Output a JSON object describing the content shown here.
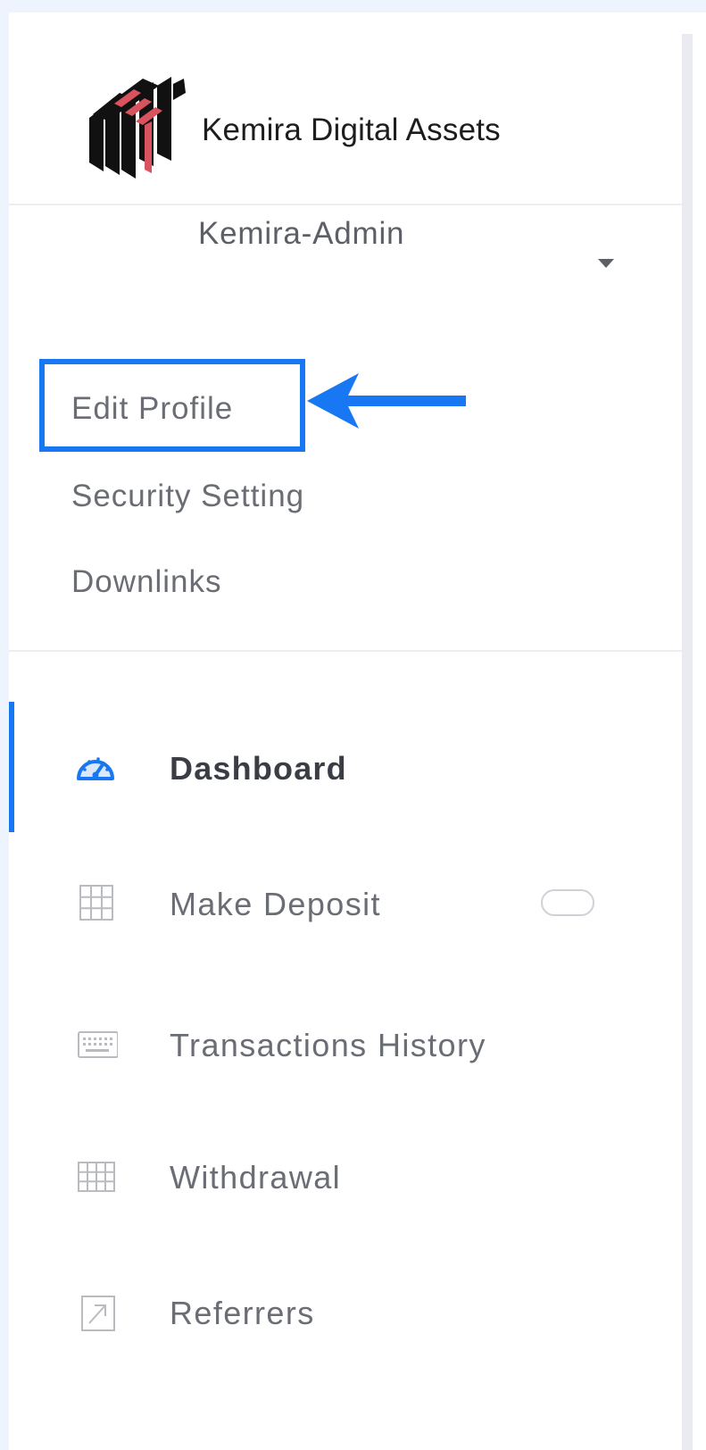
{
  "brand": {
    "name": "Kemira Digital Assets",
    "logo_icon": "kemira-logo-icon"
  },
  "user": {
    "name": "Kemira-Admin",
    "caret_icon": "caret-down-icon"
  },
  "profile_menu": [
    {
      "label": "Edit Profile",
      "highlighted": true
    },
    {
      "label": "Security Setting"
    },
    {
      "label": "Downlinks"
    }
  ],
  "nav": [
    {
      "label": "Dashboard",
      "icon": "dashboard-gauge-icon",
      "active": true
    },
    {
      "label": "Make Deposit",
      "icon": "grid-icon",
      "toggle": true
    },
    {
      "label": "Transactions History",
      "icon": "keyboard-icon"
    },
    {
      "label": "Withdrawal",
      "icon": "table-grid-icon"
    },
    {
      "label": "Referrers",
      "icon": "external-link-icon"
    }
  ],
  "colors": {
    "accent": "#1877f2",
    "logo_red": "#d9535f",
    "text_muted": "#6b6d74"
  }
}
